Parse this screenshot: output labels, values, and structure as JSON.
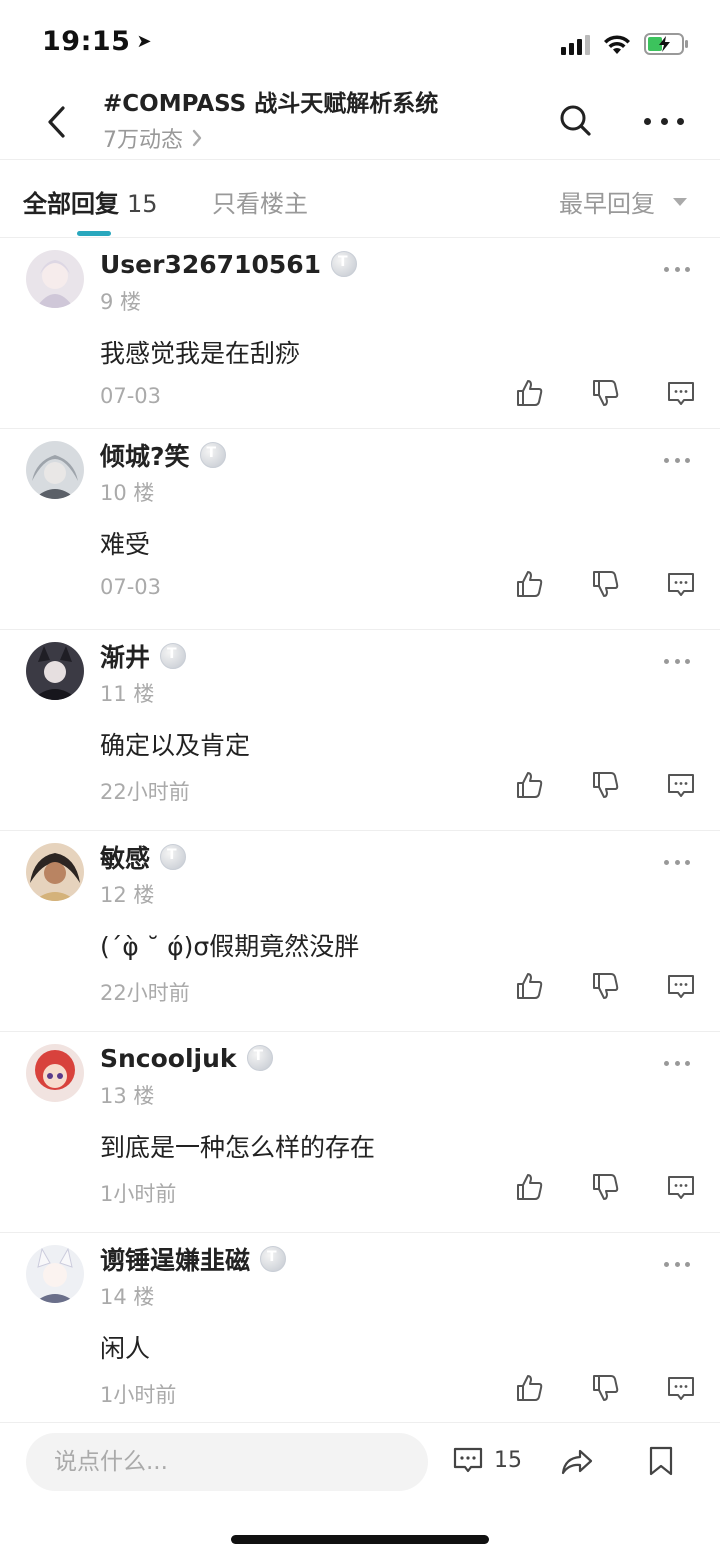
{
  "status_bar": {
    "time": "19:15"
  },
  "header": {
    "title": "#COMPASS 战斗天赋解析系统",
    "subtitle": "7万动态"
  },
  "tabs": {
    "all_label": "全部回复",
    "all_count": "15",
    "op_only_label": "只看楼主",
    "sort_label": "最早回复"
  },
  "comments": [
    {
      "username": "User326710561",
      "floor": "9 楼",
      "content": "我感觉我是在刮痧",
      "time": "07-03"
    },
    {
      "username": "倾城?笑",
      "floor": "10 楼",
      "content": "难受",
      "time": "07-03"
    },
    {
      "username": "渐井",
      "floor": "11 楼",
      "content": "确定以及肯定",
      "time": "22小时前"
    },
    {
      "username": "敏感",
      "floor": "12 楼",
      "content": "(´φ̀ ˘ φ́)σ假期竟然没胖",
      "time": "22小时前"
    },
    {
      "username": "Sncooljuk",
      "floor": "13 楼",
      "content": "到底是一种怎么样的存在",
      "time": "1小时前"
    },
    {
      "username": "谫锤逞嫌韭磁",
      "floor": "14 楼",
      "content": "闲人",
      "time": "1小时前"
    }
  ],
  "bottom_bar": {
    "input_placeholder": "说点什么...",
    "comment_count": "15"
  },
  "colors": {
    "accent": "#29a7bd"
  }
}
